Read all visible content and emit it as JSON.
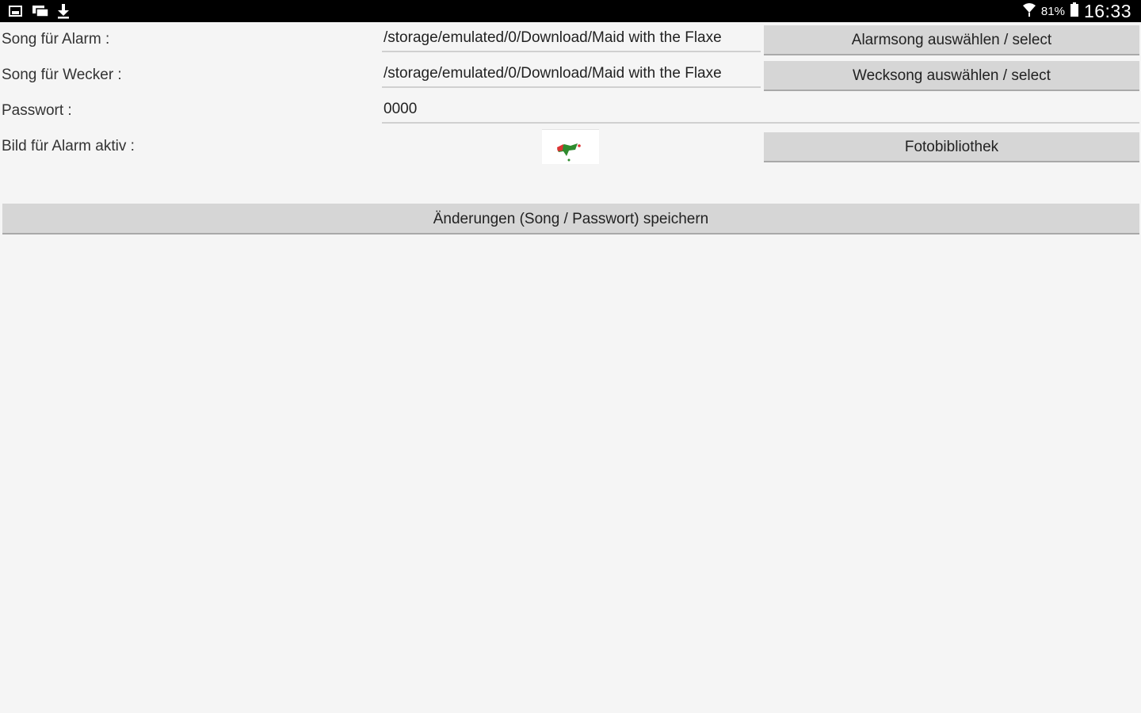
{
  "statusbar": {
    "left_icons": [
      "gallery-icon",
      "message-icon",
      "download-icon"
    ],
    "signal_icon": "wifi-signal-icon",
    "battery_percent": "81%",
    "battery_icon": "battery-icon",
    "time": "16:33"
  },
  "form": {
    "alarm_song": {
      "label": "Song für Alarm :",
      "value": "/storage/emulated/0/Download/Maid with the Flaxe",
      "button": "Alarmsong auswählen / select"
    },
    "wecker_song": {
      "label": "Song für Wecker :",
      "value": "/storage/emulated/0/Download/Maid with the Flaxe",
      "button": "Wecksong auswählen / select"
    },
    "password": {
      "label": "Passwort :",
      "value": "0000"
    },
    "image": {
      "label": "Bild für Alarm aktiv :",
      "thumbnail_icon": "alarm-image-thumbnail",
      "button": "Fotobibliothek"
    },
    "save_button": "Änderungen (Song / Passwort) speichern"
  },
  "colors": {
    "background": "#f5f5f5",
    "statusbar": "#000000",
    "button": "#d6d6d6"
  }
}
